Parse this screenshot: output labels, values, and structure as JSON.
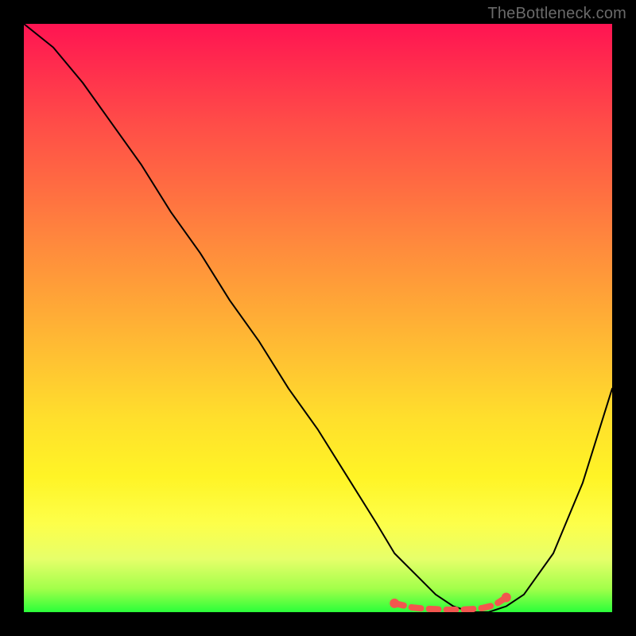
{
  "watermark": "TheBottleneck.com",
  "chart_data": {
    "type": "line",
    "title": "",
    "xlabel": "",
    "ylabel": "",
    "xlim": [
      0,
      100
    ],
    "ylim": [
      0,
      100
    ],
    "grid": false,
    "legend": false,
    "series": [
      {
        "name": "bottleneck-curve",
        "color": "#000000",
        "x": [
          0,
          5,
          10,
          15,
          20,
          25,
          30,
          35,
          40,
          45,
          50,
          55,
          60,
          63,
          67,
          70,
          73,
          76,
          79,
          82,
          85,
          90,
          95,
          100
        ],
        "y": [
          100,
          96,
          90,
          83,
          76,
          68,
          61,
          53,
          46,
          38,
          31,
          23,
          15,
          10,
          6,
          3,
          1,
          0,
          0,
          1,
          3,
          10,
          22,
          38
        ]
      },
      {
        "name": "optimal-range-markers",
        "color": "#f2564e",
        "x": [
          63,
          66,
          68,
          70,
          72,
          74,
          76,
          78,
          80,
          82
        ],
        "y": [
          1.5,
          0.8,
          0.6,
          0.5,
          0.4,
          0.4,
          0.5,
          0.7,
          1.2,
          2.5
        ]
      }
    ],
    "gradient_stops": [
      {
        "pos": 0.0,
        "color": "#ff1452"
      },
      {
        "pos": 0.17,
        "color": "#ff4d48"
      },
      {
        "pos": 0.37,
        "color": "#ff883d"
      },
      {
        "pos": 0.57,
        "color": "#ffc232"
      },
      {
        "pos": 0.77,
        "color": "#fff426"
      },
      {
        "pos": 0.91,
        "color": "#e6ff6a"
      },
      {
        "pos": 1.0,
        "color": "#2bff3a"
      }
    ]
  }
}
